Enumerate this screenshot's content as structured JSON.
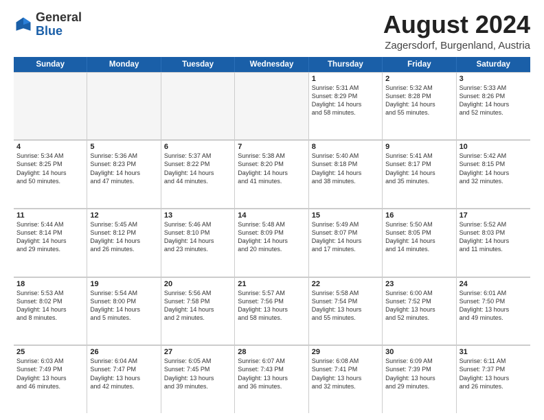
{
  "logo": {
    "general": "General",
    "blue": "Blue"
  },
  "title": {
    "month_year": "August 2024",
    "location": "Zagersdorf, Burgenland, Austria"
  },
  "header_days": [
    "Sunday",
    "Monday",
    "Tuesday",
    "Wednesday",
    "Thursday",
    "Friday",
    "Saturday"
  ],
  "weeks": [
    {
      "cells": [
        {
          "day": "",
          "detail": "",
          "empty": true
        },
        {
          "day": "",
          "detail": "",
          "empty": true
        },
        {
          "day": "",
          "detail": "",
          "empty": true
        },
        {
          "day": "",
          "detail": "",
          "empty": true
        },
        {
          "day": "1",
          "detail": "Sunrise: 5:31 AM\nSunset: 8:29 PM\nDaylight: 14 hours\nand 58 minutes."
        },
        {
          "day": "2",
          "detail": "Sunrise: 5:32 AM\nSunset: 8:28 PM\nDaylight: 14 hours\nand 55 minutes."
        },
        {
          "day": "3",
          "detail": "Sunrise: 5:33 AM\nSunset: 8:26 PM\nDaylight: 14 hours\nand 52 minutes."
        }
      ]
    },
    {
      "cells": [
        {
          "day": "4",
          "detail": "Sunrise: 5:34 AM\nSunset: 8:25 PM\nDaylight: 14 hours\nand 50 minutes."
        },
        {
          "day": "5",
          "detail": "Sunrise: 5:36 AM\nSunset: 8:23 PM\nDaylight: 14 hours\nand 47 minutes."
        },
        {
          "day": "6",
          "detail": "Sunrise: 5:37 AM\nSunset: 8:22 PM\nDaylight: 14 hours\nand 44 minutes."
        },
        {
          "day": "7",
          "detail": "Sunrise: 5:38 AM\nSunset: 8:20 PM\nDaylight: 14 hours\nand 41 minutes."
        },
        {
          "day": "8",
          "detail": "Sunrise: 5:40 AM\nSunset: 8:18 PM\nDaylight: 14 hours\nand 38 minutes."
        },
        {
          "day": "9",
          "detail": "Sunrise: 5:41 AM\nSunset: 8:17 PM\nDaylight: 14 hours\nand 35 minutes."
        },
        {
          "day": "10",
          "detail": "Sunrise: 5:42 AM\nSunset: 8:15 PM\nDaylight: 14 hours\nand 32 minutes."
        }
      ]
    },
    {
      "cells": [
        {
          "day": "11",
          "detail": "Sunrise: 5:44 AM\nSunset: 8:14 PM\nDaylight: 14 hours\nand 29 minutes."
        },
        {
          "day": "12",
          "detail": "Sunrise: 5:45 AM\nSunset: 8:12 PM\nDaylight: 14 hours\nand 26 minutes."
        },
        {
          "day": "13",
          "detail": "Sunrise: 5:46 AM\nSunset: 8:10 PM\nDaylight: 14 hours\nand 23 minutes."
        },
        {
          "day": "14",
          "detail": "Sunrise: 5:48 AM\nSunset: 8:09 PM\nDaylight: 14 hours\nand 20 minutes."
        },
        {
          "day": "15",
          "detail": "Sunrise: 5:49 AM\nSunset: 8:07 PM\nDaylight: 14 hours\nand 17 minutes."
        },
        {
          "day": "16",
          "detail": "Sunrise: 5:50 AM\nSunset: 8:05 PM\nDaylight: 14 hours\nand 14 minutes."
        },
        {
          "day": "17",
          "detail": "Sunrise: 5:52 AM\nSunset: 8:03 PM\nDaylight: 14 hours\nand 11 minutes."
        }
      ]
    },
    {
      "cells": [
        {
          "day": "18",
          "detail": "Sunrise: 5:53 AM\nSunset: 8:02 PM\nDaylight: 14 hours\nand 8 minutes."
        },
        {
          "day": "19",
          "detail": "Sunrise: 5:54 AM\nSunset: 8:00 PM\nDaylight: 14 hours\nand 5 minutes."
        },
        {
          "day": "20",
          "detail": "Sunrise: 5:56 AM\nSunset: 7:58 PM\nDaylight: 14 hours\nand 2 minutes."
        },
        {
          "day": "21",
          "detail": "Sunrise: 5:57 AM\nSunset: 7:56 PM\nDaylight: 13 hours\nand 58 minutes."
        },
        {
          "day": "22",
          "detail": "Sunrise: 5:58 AM\nSunset: 7:54 PM\nDaylight: 13 hours\nand 55 minutes."
        },
        {
          "day": "23",
          "detail": "Sunrise: 6:00 AM\nSunset: 7:52 PM\nDaylight: 13 hours\nand 52 minutes."
        },
        {
          "day": "24",
          "detail": "Sunrise: 6:01 AM\nSunset: 7:50 PM\nDaylight: 13 hours\nand 49 minutes."
        }
      ]
    },
    {
      "cells": [
        {
          "day": "25",
          "detail": "Sunrise: 6:03 AM\nSunset: 7:49 PM\nDaylight: 13 hours\nand 46 minutes."
        },
        {
          "day": "26",
          "detail": "Sunrise: 6:04 AM\nSunset: 7:47 PM\nDaylight: 13 hours\nand 42 minutes."
        },
        {
          "day": "27",
          "detail": "Sunrise: 6:05 AM\nSunset: 7:45 PM\nDaylight: 13 hours\nand 39 minutes."
        },
        {
          "day": "28",
          "detail": "Sunrise: 6:07 AM\nSunset: 7:43 PM\nDaylight: 13 hours\nand 36 minutes."
        },
        {
          "day": "29",
          "detail": "Sunrise: 6:08 AM\nSunset: 7:41 PM\nDaylight: 13 hours\nand 32 minutes."
        },
        {
          "day": "30",
          "detail": "Sunrise: 6:09 AM\nSunset: 7:39 PM\nDaylight: 13 hours\nand 29 minutes."
        },
        {
          "day": "31",
          "detail": "Sunrise: 6:11 AM\nSunset: 7:37 PM\nDaylight: 13 hours\nand 26 minutes."
        }
      ]
    }
  ]
}
